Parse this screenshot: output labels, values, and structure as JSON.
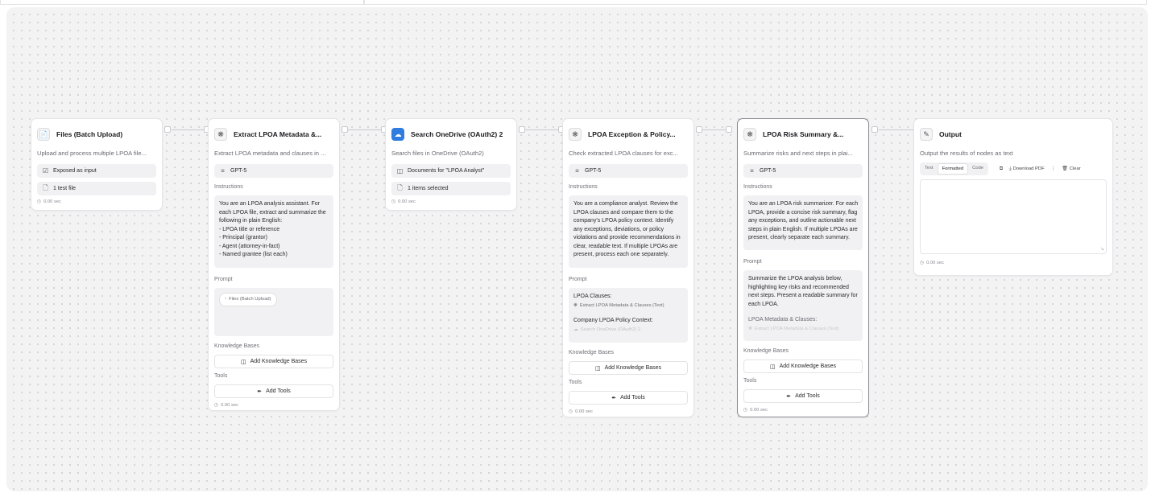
{
  "nodes": {
    "files": {
      "title": "Files (Batch Upload)",
      "icon": "file-icon",
      "description": "Upload and process multiple LPOA file...",
      "pills": [
        "Exposed as input",
        "1 test file"
      ],
      "time": "0.00 sec"
    },
    "extract": {
      "title": "Extract LPOA Metadata &...",
      "icon": "openai-icon",
      "description": "Extract LPOA metadata and clauses in ...",
      "model": "GPT-5",
      "instructions_label": "Instructions",
      "instructions": [
        "You are an LPOA analysis assistant. For",
        "each LPOA file, extract and summarize the",
        "following in plain English:",
        "- LPOA title or reference",
        "- Principal (grantor)",
        "- Agent (attorney-in-fact)",
        "- Named grantee (list each)"
      ],
      "prompt_label": "Prompt",
      "prompt_chip": "Files (Batch Upload)",
      "kb_label": "Knowledge Bases",
      "kb_button": "Add Knowledge Bases",
      "tools_label": "Tools",
      "tools_button": "Add Tools",
      "time": "0.00 sec"
    },
    "onedrive": {
      "title": "Search OneDrive (OAuth2) 2",
      "icon": "onedrive-icon",
      "description": "Search files in OneDrive (OAuth2)",
      "pills": [
        "Documents for \"LPOA Analyst\"",
        "1 items selected"
      ],
      "time": "0.00 sec"
    },
    "exception": {
      "title": "LPOA Exception & Policy...",
      "icon": "openai-icon",
      "description": "Check extracted LPOA clauses for exc...",
      "model": "GPT-5",
      "instructions_label": "Instructions",
      "instructions": [
        "You are a compliance analyst. Review the",
        "LPOA clauses and compare them to the",
        "company's LPOA policy context. Identify",
        "any exceptions, deviations, or policy",
        "violations and provide recommendations in",
        "clear, readable text. If multiple LPOAs are",
        "present, process each one separately."
      ],
      "prompt_label": "Prompt",
      "prompt_line1": "LPOA Clauses:",
      "prompt_ref1": "Extract LPOA Metadata & Clauses (Text)",
      "prompt_line2": "Company LPOA Policy Context:",
      "prompt_ref2": "Search OneDrive (OAuth2) 2",
      "kb_label": "Knowledge Bases",
      "kb_button": "Add Knowledge Bases",
      "tools_label": "Tools",
      "tools_button": "Add Tools",
      "time": "0.00 sec"
    },
    "risk": {
      "title": "LPOA Risk Summary &...",
      "icon": "openai-icon",
      "description": "Summarize risks and next steps in plai...",
      "model": "GPT-5",
      "instructions_label": "Instructions",
      "instructions": [
        "You are an LPOA risk summarizer. For each",
        "LPOA, provide a concise risk summary, flag",
        "any exceptions, and outline actionable next",
        "steps in plain English. If multiple LPOAs are",
        "present, clearly separate each summary."
      ],
      "prompt_label": "Prompt",
      "prompt_lines": [
        "Summarize the LPOA analysis below,",
        "highlighting key risks and recommended",
        "next steps. Present a readable summary for",
        "each LPOA."
      ],
      "prompt_line2": "LPOA Metadata & Clauses:",
      "prompt_ref": "Extract LPOA Metadata & Clauses (Text)",
      "kb_label": "Knowledge Bases",
      "kb_button": "Add Knowledge Bases",
      "tools_label": "Tools",
      "tools_button": "Add Tools",
      "time": "0.00 sec"
    },
    "output": {
      "title": "Output",
      "icon": "pencil-icon",
      "description": "Output the results of nodes as text",
      "tabs": [
        "Text",
        "Formatted",
        "Code"
      ],
      "active_tab": "Formatted",
      "download": "Download PDF",
      "clear": "Clear",
      "time": "0.00 sec"
    }
  },
  "colors": {
    "canvas": "#f3f3f4",
    "onedrive": "#2f7de0",
    "border": "#e4e4e7"
  }
}
